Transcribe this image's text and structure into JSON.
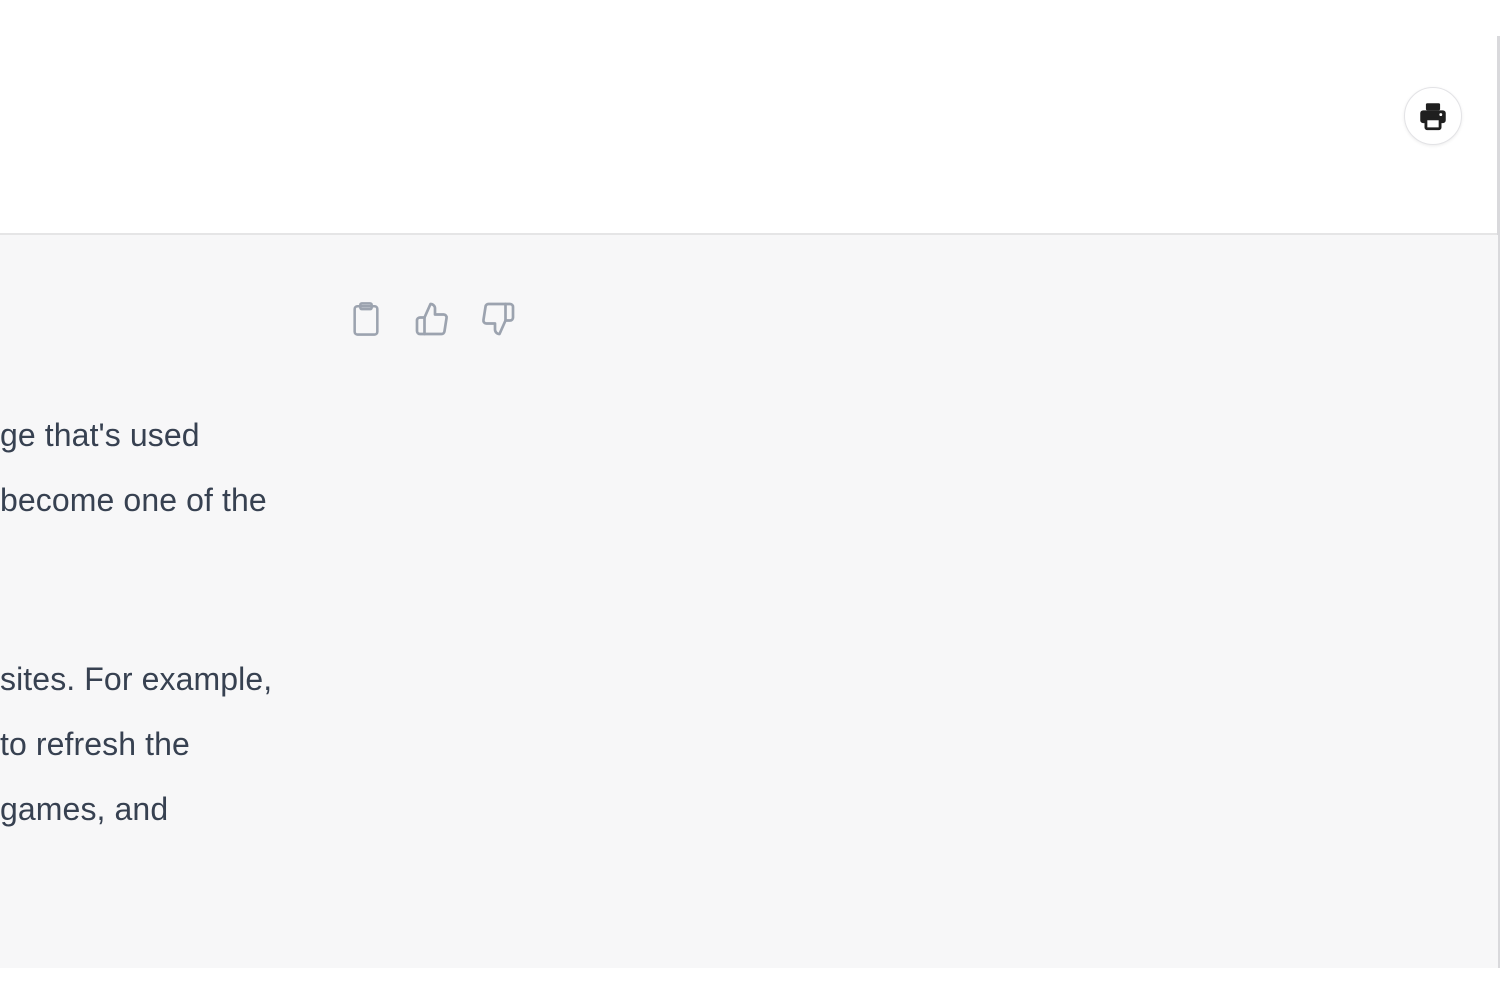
{
  "header": {
    "print_icon": "printer-icon"
  },
  "message": {
    "actions": {
      "copy_icon": "clipboard-icon",
      "like_icon": "thumbs-up-icon",
      "dislike_icon": "thumbs-down-icon"
    },
    "paragraph_1": [
      "ge that's used",
      "become one of the"
    ],
    "paragraph_2": [
      "sites. For example,",
      "to refresh the",
      "games, and"
    ]
  },
  "colors": {
    "content_background": "#f7f7f8",
    "text": "#374151",
    "icon": "#9ca3af"
  }
}
